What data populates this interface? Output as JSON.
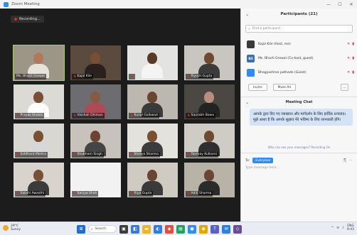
{
  "window": {
    "title": "Zoom Meeting",
    "controls": [
      "—",
      "☐",
      "✕"
    ]
  },
  "recording": {
    "label": "Recording..."
  },
  "participants_grid": [
    {
      "name": "Ms. Bharti Grewal",
      "muted": false,
      "active": true,
      "bg": "#9c9686",
      "skin": "#b07a5a",
      "shirt": "#e6e3da"
    },
    {
      "name": "Kajal Kile",
      "muted": true,
      "bg": "#5b4b3f",
      "skin": "#7a4e34",
      "shirt": "#2a2020"
    },
    {
      "name": "",
      "muted": true,
      "bg": "#e3e3e1",
      "skin": "#5a3a26",
      "shirt": "#f4f4f4"
    },
    {
      "name": "Piyush Gupta",
      "muted": true,
      "bg": "#c9c6bf",
      "skin": "#6e4a32",
      "shirt": "#3b3b3b"
    },
    {
      "name": "Prayas Shukla",
      "muted": true,
      "bg": "#dcdad5",
      "skin": "#7a5034",
      "shirt": "#ffffff"
    },
    {
      "name": "Vaishali Dhiman",
      "muted": true,
      "bg": "#6d6c71",
      "skin": "#8a5a3c",
      "shirt": "#b04a55"
    },
    {
      "name": "Kunal Gaikwad",
      "muted": true,
      "bg": "#bcb8b0",
      "skin": "#6a4530",
      "shirt": "#3a3a3a"
    },
    {
      "name": "Saurabh Bawa",
      "muted": true,
      "bg": "#4b4743",
      "skin": "#b88f7a",
      "shirt": "#232323"
    },
    {
      "name": "Siddhant Mishra",
      "muted": true,
      "bg": "#d9d7d1",
      "skin": "#7a5034",
      "shirt": "#d7d7d7"
    },
    {
      "name": "Shubham Singh",
      "muted": true,
      "bg": "#c7c3bc",
      "skin": "#6a4530",
      "shirt": "#454545"
    },
    {
      "name": "Shreya Sharma",
      "muted": true,
      "bg": "#e4e2dc",
      "skin": "#7a5034",
      "shirt": "#3c3c3c"
    },
    {
      "name": "Tanmay Kulkarni",
      "muted": true,
      "bg": "#cfccc6",
      "skin": "#6e4a32",
      "shirt": "#2f2f2f"
    },
    {
      "name": "Sakshi Awasthi",
      "muted": true,
      "bg": "#d8d4cd",
      "skin": "#7a5034",
      "shirt": "#3b3b3b"
    },
    {
      "name": "Saniya Shah",
      "muted": true,
      "bg": "#f2f2f2",
      "skin": "#f2f2f2",
      "shirt": "#f2f2f2"
    },
    {
      "name": "Riya Gupta",
      "muted": true,
      "bg": "#cfcac2",
      "skin": "#6a4530",
      "shirt": "#3a3a3a"
    },
    {
      "name": "Aditi Sharma",
      "muted": true,
      "bg": "#b8b2a7",
      "skin": "#6a4530",
      "shirt": "#2b2b2b"
    }
  ],
  "panel": {
    "title": "Participants (21)",
    "search_placeholder": "Find a participant",
    "participants": [
      {
        "initials": "",
        "name": "Kajal Kile (Host, me)",
        "avatar_color": "#3a3a3a"
      },
      {
        "initials": "BG",
        "name": "Ms. Bharti Grewal (Co-host, guest)",
        "avatar_color": "#3b6fb6"
      },
      {
        "initials": "",
        "name": "Bhagyashree pathade (Guest)",
        "avatar_color": "#2d8cff"
      }
    ],
    "invite_label": "Invite",
    "mute_all_label": "Mute All",
    "more_label": "...",
    "chat_title": "Meeting Chat",
    "chat_message": "आपके द्वारा दिए गए व्याख्यान और मार्गदर्शन के लिए हार्दिक धन्यवाद। मुझे आशा है कि आपके सुझाव मेरे भविष्य के लिए लाभकारी होंगे।",
    "chat_note": "Who can see your messages? Recording On",
    "to_label": "To:",
    "to_chip": "Everyone",
    "input_placeholder": "Type message here..."
  },
  "taskbar": {
    "weather_temp": "29°C",
    "weather_desc": "Sunny",
    "search_label": "Search",
    "clock_time": "9:43",
    "clock_date": "ENG"
  }
}
